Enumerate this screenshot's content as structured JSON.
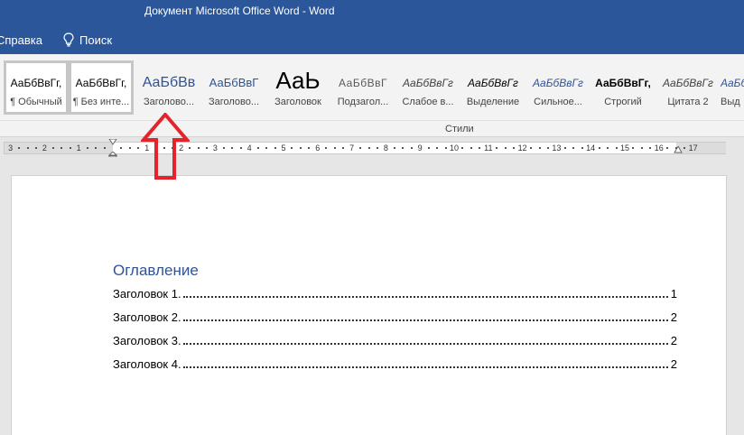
{
  "window": {
    "title": "Документ Microsoft Office Word  -  Word"
  },
  "menubar": {
    "help_tab": "Справка",
    "tellme_label": "Поиск"
  },
  "ribbon": {
    "group_label": "Стили",
    "styles": [
      {
        "preview": "АаБбВвГг,",
        "label": "¶ Обычный",
        "selected": true
      },
      {
        "preview": "АаБбВвГг,",
        "label": "¶ Без инте...",
        "selected": true
      },
      {
        "preview": "АаБбВв",
        "label": "Заголово..."
      },
      {
        "preview": "АаБбВвГ",
        "label": "Заголово..."
      },
      {
        "preview": "АаЬ",
        "label": "Заголовок"
      },
      {
        "preview": "АаБбВвГ",
        "label": "Подзагол..."
      },
      {
        "preview": "АаБбВвГг",
        "label": "Слабое в..."
      },
      {
        "preview": "АаБбВвГг",
        "label": "Выделение"
      },
      {
        "preview": "АаБбВвГг",
        "label": "Сильное..."
      },
      {
        "preview": "АаБбВвГг,",
        "label": "Строгий"
      },
      {
        "preview": "АаБбВвГг",
        "label": "Цитата 2"
      },
      {
        "preview": "АаБб",
        "label": "Выд"
      }
    ]
  },
  "ruler": {
    "left_numbers": [
      "3",
      "2",
      "1"
    ],
    "right_numbers": [
      "1",
      "2",
      "3",
      "4",
      "5",
      "6",
      "7",
      "8",
      "9",
      "10",
      "11",
      "12",
      "13",
      "14",
      "15",
      "16",
      "17"
    ]
  },
  "document": {
    "toc_title": "Оглавление",
    "entries": [
      {
        "text": "Заголовок 1.",
        "page": "1"
      },
      {
        "text": "Заголовок 2.",
        "page": "2"
      },
      {
        "text": "Заголовок 3.",
        "page": "2"
      },
      {
        "text": "Заголовок 4.",
        "page": "2"
      }
    ]
  },
  "colors": {
    "titlebar": "#2b579a",
    "heading_blue": "#2f5496",
    "annotation_red": "#e3242b"
  },
  "icons": {
    "tellme": "lightbulb-icon",
    "annotation": "red-up-arrow"
  }
}
